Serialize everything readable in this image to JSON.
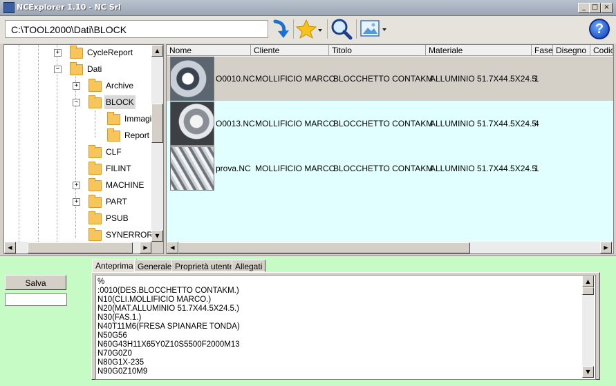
{
  "window": {
    "title": "NCExplorer 1.10 - NC Srl",
    "min_label": "_",
    "max_label": "□",
    "close_label": "×"
  },
  "toolbar": {
    "path": "C:\\TOOL2000\\Dati\\BLOCK",
    "icons": [
      "go-arrow-icon",
      "favorites-star-icon",
      "search-magnifier-icon",
      "image-view-icon",
      "help-icon"
    ],
    "help_label": "?"
  },
  "tree": {
    "items": [
      {
        "label": "CycleReport",
        "expander": "+"
      },
      {
        "label": "Dati",
        "expander": "−"
      },
      {
        "label": "Archive",
        "expander": "+"
      },
      {
        "label": "BLOCK",
        "expander": "−"
      },
      {
        "label": "Immagin",
        "expander": ""
      },
      {
        "label": "Report",
        "expander": ""
      },
      {
        "label": "CLF",
        "expander": ""
      },
      {
        "label": "FILINT",
        "expander": ""
      },
      {
        "label": "MACHINE",
        "expander": "+"
      },
      {
        "label": "PART",
        "expander": "+"
      },
      {
        "label": "PSUB",
        "expander": ""
      },
      {
        "label": "SYNERROR",
        "expander": ""
      }
    ]
  },
  "list": {
    "columns": [
      "Nome",
      "Cliente",
      "Titolo",
      "Materiale",
      "Fase",
      "Disegno",
      "Codic"
    ],
    "rows": [
      {
        "nome": "O0010.NC",
        "cliente": "MOLLIFICIO MARCO",
        "titolo": "BLOCCHETTO CONTAKM",
        "materiale": "ALLUMINIO 51.7X44.5X24.5",
        "fase": "1"
      },
      {
        "nome": "O0013.NC",
        "cliente": "MOLLIFICIO MARCO",
        "titolo": "BLOCCHETTO CONTAKM",
        "materiale": "ALLUMINIO 51.7X44.5X24.5",
        "fase": "4"
      },
      {
        "nome": "prova.NC",
        "cliente": "MOLLIFICIO MARCO",
        "titolo": "BLOCCHETTO CONTAKM",
        "materiale": "ALLUMINIO 51.7X44.5X24.5",
        "fase": "1"
      }
    ]
  },
  "bottom": {
    "save_label": "Salva",
    "tabs": [
      "Anteprima",
      "Generale",
      "Proprietà utente",
      "Allegati"
    ],
    "code_lines": [
      "%",
      ":0010(DES.BLOCCHETTO CONTAKM.)",
      "N10(CLI.MOLLIFICIO MARCO.)",
      "N20(MAT.ALLUMINIO 51.7X44.5X24.5.)",
      "N30(FAS.1.)",
      "N40T11M6(FRESA SPIANARE TONDA)",
      "N50G56",
      "N60G43H11X65Y0Z10S5500F2000M13",
      "N70G0Z0",
      "N80G1X-235",
      "N90G0Z10M9"
    ]
  },
  "colors": {
    "accent_green": "#c6fbc6",
    "list_bg": "#e1fffe",
    "selected_row": "#d4d0c8"
  }
}
